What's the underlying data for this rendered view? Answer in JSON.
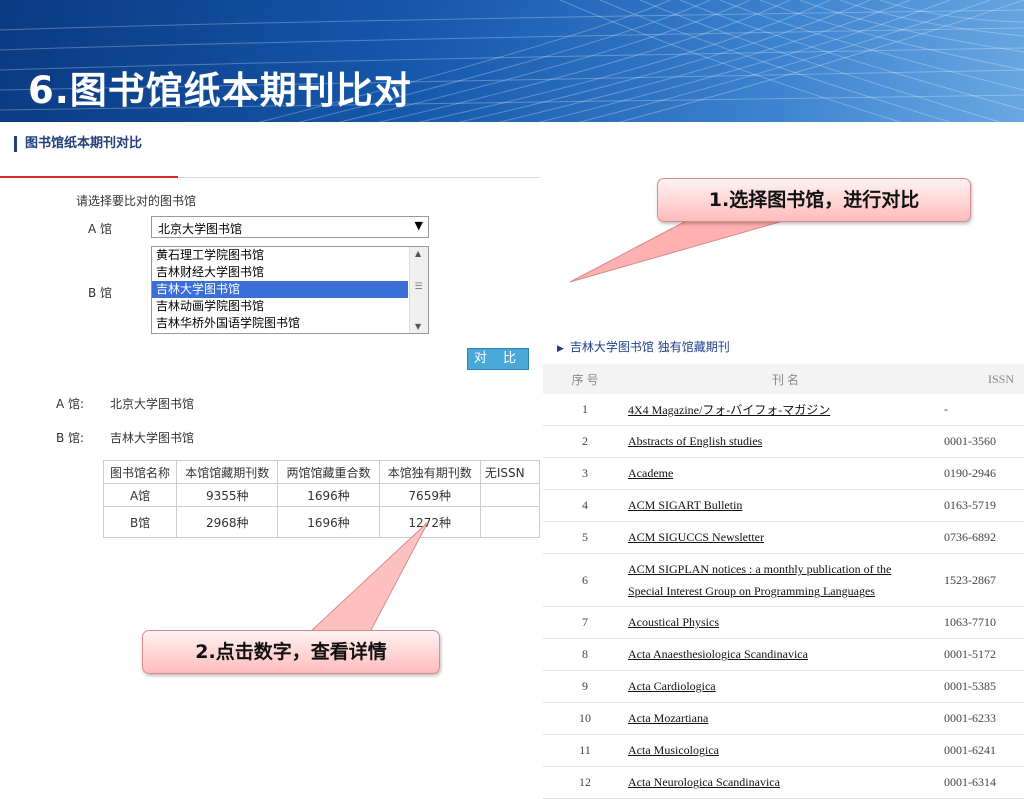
{
  "slide": {
    "title": "6.图书馆纸本期刊比对"
  },
  "panel": {
    "heading": "图书馆纸本期刊对比",
    "prompt": "请选择要比对的图书馆",
    "a_label": "A 馆",
    "b_label": "B 馆",
    "a_selected": "北京大学图书馆",
    "b_options": [
      "黄石理工学院图书馆",
      "吉林财经大学图书馆",
      "吉林大学图书馆",
      "吉林动画学院图书馆",
      "吉林华桥外国语学院图书馆"
    ],
    "b_selected_index": 2,
    "compare_button": "对 比",
    "result_a_label": "A 馆:",
    "result_a_value": "北京大学图书馆",
    "result_b_label": "B 馆:",
    "result_b_value": "吉林大学图书馆"
  },
  "compare_table": {
    "headers": [
      "图书馆名称",
      "本馆馆藏期刊数",
      "两馆馆藏重合数",
      "本馆独有期刊数",
      "无ISSN"
    ],
    "rows": [
      [
        "A馆",
        "9355种",
        "1696种",
        "7659种",
        ""
      ],
      [
        "B馆",
        "2968种",
        "1696种",
        "1272种",
        ""
      ]
    ]
  },
  "unique_list": {
    "title": "吉林大学图书馆 独有馆藏期刊",
    "headers": [
      "序 号",
      "刊 名",
      "ISSN"
    ],
    "rows": [
      {
        "no": "1",
        "name": "4X4 Magazine/フォ-バイフォ-マガジン",
        "issn": "-"
      },
      {
        "no": "2",
        "name": "Abstracts of English studies",
        "issn": "0001-3560"
      },
      {
        "no": "3",
        "name": "Academe",
        "issn": "0190-2946"
      },
      {
        "no": "4",
        "name": "ACM SIGART Bulletin",
        "issn": "0163-5719"
      },
      {
        "no": "5",
        "name": "ACM SIGUCCS Newsletter",
        "issn": "0736-6892"
      },
      {
        "no": "6",
        "name": "ACM SIGPLAN notices : a monthly publication of the",
        "name2": "Special Interest Group on Programming Languages",
        "issn": "1523-2867"
      },
      {
        "no": "7",
        "name": "Acoustical Physics",
        "issn": "1063-7710"
      },
      {
        "no": "8",
        "name": "Acta Anaesthesiologica Scandinavica",
        "issn": "0001-5172"
      },
      {
        "no": "9",
        "name": "Acta Cardiologica",
        "issn": "0001-5385"
      },
      {
        "no": "10",
        "name": "Acta Mozartiana",
        "issn": "0001-6233"
      },
      {
        "no": "11",
        "name": "Acta Musicologica",
        "issn": "0001-6241"
      },
      {
        "no": "12",
        "name": "Acta Neurologica Scandinavica",
        "issn": "0001-6314"
      }
    ]
  },
  "callouts": {
    "step1": "1.选择图书馆，进行对比",
    "step2": "2.点击数字，查看详情"
  },
  "colors": {
    "banner": "#1557ab",
    "callout": "#ffc8c8",
    "selected": "#3a6fd8",
    "button": "#4aa8d8"
  }
}
